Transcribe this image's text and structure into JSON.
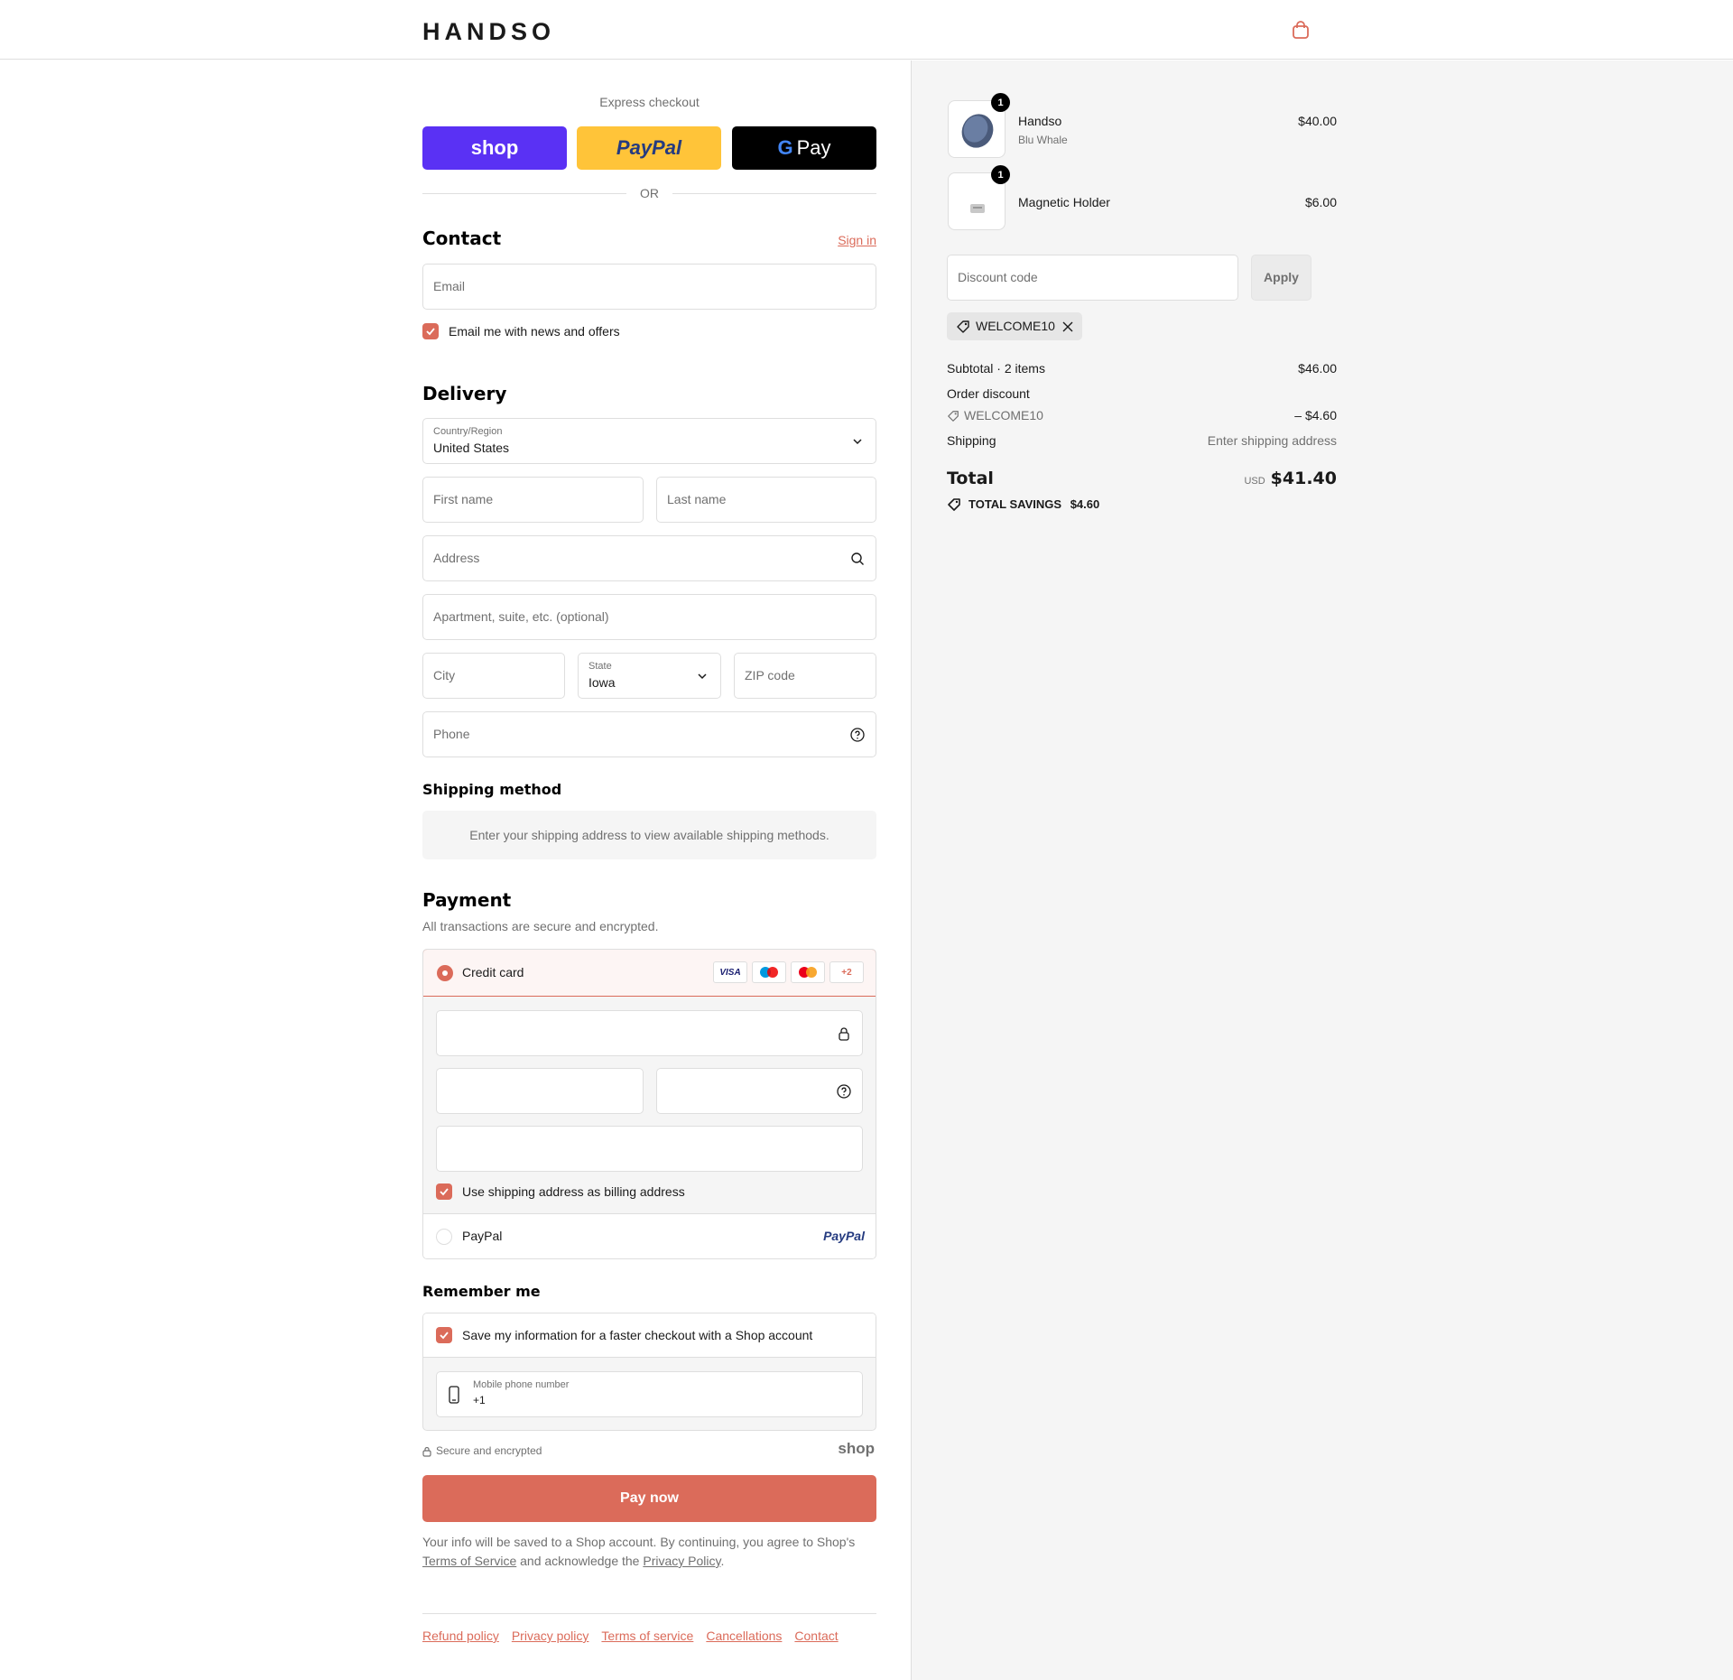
{
  "header": {
    "brand": "HANDSO"
  },
  "express": {
    "title": "Express checkout",
    "shop_label": "shop",
    "paypal_label": "PayPal",
    "gpay_label": "Pay",
    "or_label": "OR"
  },
  "contact": {
    "title": "Contact",
    "sign_in": "Sign in",
    "email_placeholder": "Email",
    "news_label": "Email me with news and offers"
  },
  "delivery": {
    "title": "Delivery",
    "country_label": "Country/Region",
    "country_value": "United States",
    "first_name": "First name",
    "last_name": "Last name",
    "address": "Address",
    "apartment": "Apartment, suite, etc. (optional)",
    "city": "City",
    "state_label": "State",
    "state_value": "Iowa",
    "zip": "ZIP code",
    "phone": "Phone"
  },
  "shipping_method": {
    "title": "Shipping method",
    "message": "Enter your shipping address to view available shipping methods."
  },
  "payment": {
    "title": "Payment",
    "subtitle": "All transactions are secure and encrypted.",
    "credit_card": "Credit card",
    "badges": {
      "visa": "VISA",
      "more": "+2"
    },
    "billing_label": "Use shipping address as billing address",
    "paypal_option": "PayPal",
    "paypal_logo": "PayPal"
  },
  "remember": {
    "title": "Remember me",
    "save_label": "Save my information for a faster checkout with a Shop account",
    "phone_label": "Mobile phone number",
    "phone_value": "+1",
    "secure": "Secure and encrypted",
    "shop_logo": "shop"
  },
  "pay_button": "Pay now",
  "legal": {
    "text1": "Your info will be saved to a Shop account. By continuing, you agree to Shop's",
    "terms": "Terms of Service",
    "text2": "and acknowledge the",
    "privacy": "Privacy Policy",
    "text3": "."
  },
  "footer": {
    "links": [
      "Refund policy",
      "Privacy policy",
      "Terms of service",
      "Cancellations",
      "Contact"
    ]
  },
  "order": {
    "items": [
      {
        "name": "Handso",
        "variant": "Blu Whale",
        "price": "$40.00",
        "qty": "1"
      },
      {
        "name": "Magnetic Holder",
        "variant": "",
        "price": "$6.00",
        "qty": "1"
      }
    ],
    "discount_placeholder": "Discount code",
    "apply": "Apply",
    "applied_code": "WELCOME10",
    "subtotal_label": "Subtotal · 2 items",
    "subtotal_value": "$46.00",
    "order_discount_label": "Order discount",
    "discount_code": "WELCOME10",
    "discount_value": "– $4.60",
    "shipping_label": "Shipping",
    "shipping_value": "Enter shipping address",
    "total_label": "Total",
    "currency": "USD",
    "total_value": "$41.40",
    "savings_label": "TOTAL SAVINGS",
    "savings_value": "$4.60"
  },
  "colors": {
    "accent": "#db6b5a",
    "shop": "#5a31f4",
    "paypal": "#ffc439",
    "gpay": "#000000",
    "panel": "#f5f5f5"
  },
  "icons": [
    "cart-icon",
    "chevron-down-icon",
    "search-icon",
    "help-icon",
    "lock-icon",
    "tag-icon",
    "close-icon",
    "phone-icon",
    "check-icon"
  ]
}
